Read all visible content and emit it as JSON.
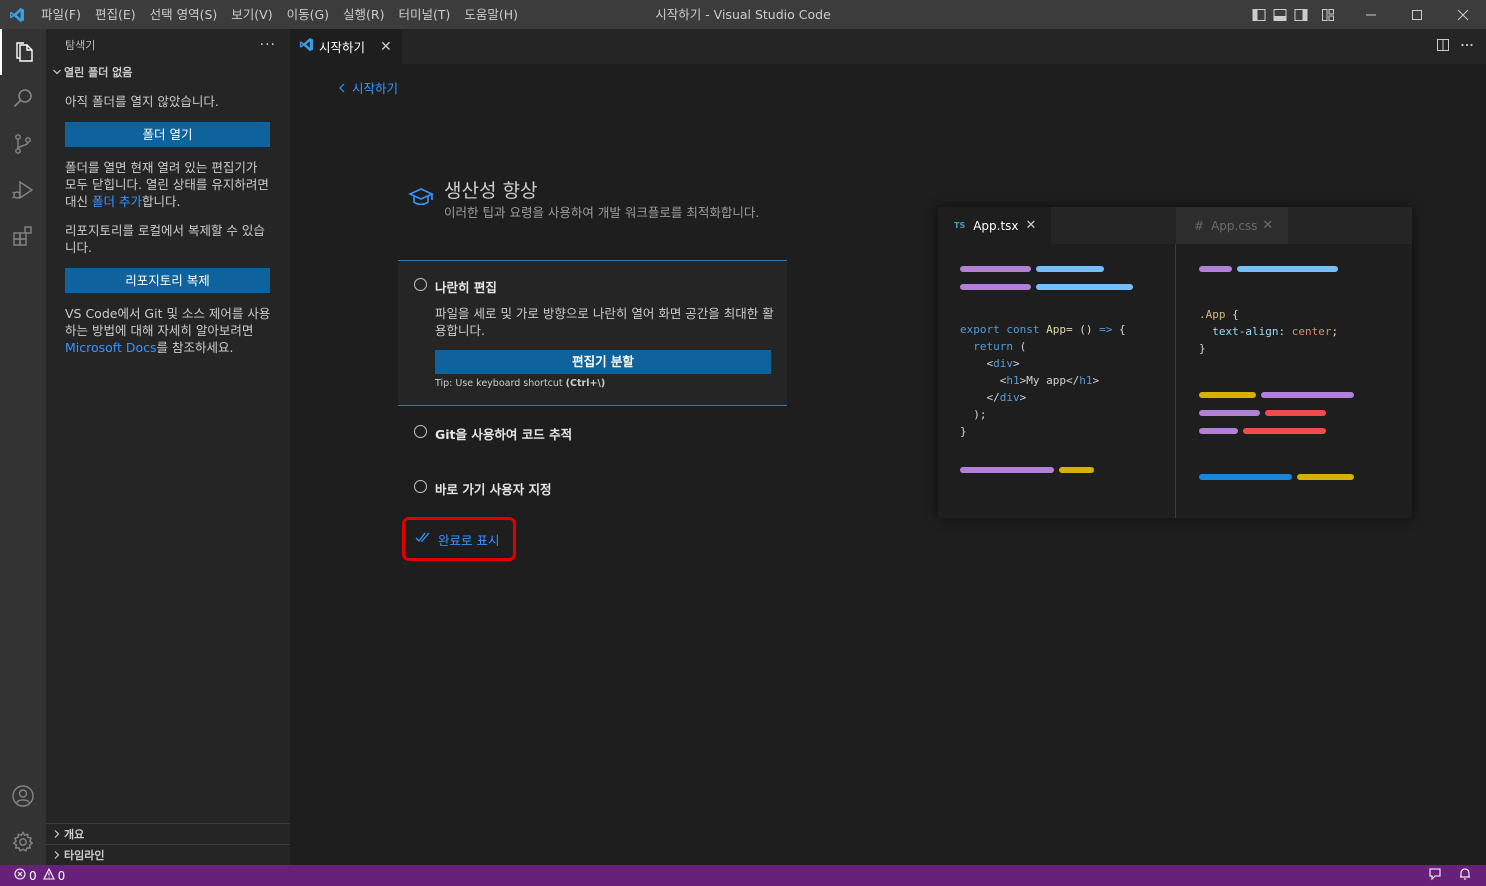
{
  "titlebar": {
    "menu": [
      "파일(F)",
      "편집(E)",
      "선택 영역(S)",
      "보기(V)",
      "이동(G)",
      "실행(R)",
      "터미널(T)",
      "도움말(H)"
    ],
    "title": "시작하기 - Visual Studio Code"
  },
  "sidebar": {
    "header": "탐색기",
    "more": "···",
    "section": "열린 폴더 없음",
    "no_folder_text": "아직 폴더를 열지 않았습니다.",
    "open_folder_button": "폴더 열기",
    "close_note_prefix": "폴더를 열면 현재 열려 있는 편집기가 모두 닫힙니다. 열린 상태를 유지하려면 대신 ",
    "close_note_link": "폴더 추가",
    "close_note_suffix": "합니다.",
    "clone_text": "리포지토리를 로컬에서 복제할 수 있습니다.",
    "clone_button": "리포지토리 복제",
    "learn_prefix": "VS Code에서 Git 및 소스 제어를 사용하는 방법에 대해 자세히 알아보려면 ",
    "learn_link": "Microsoft Docs",
    "learn_suffix": "를 참조하세요.",
    "outline": "개요",
    "timeline": "타임라인"
  },
  "tab": {
    "label": "시작하기",
    "close": "✕"
  },
  "walkthrough": {
    "back": "시작하기",
    "title": "생산성 향상",
    "subtitle": "이러한 팁과 요령을 사용하여 개발 워크플로를 최적화합니다.",
    "steps": [
      {
        "title": "나란히 편집",
        "description": "파일을 세로 및 가로 방향으로 나란히 열어 화면 공간을 최대한 활용합니다.",
        "button": "편집기 분할",
        "tip_prefix": "Tip: Use keyboard shortcut ",
        "tip_shortcut": "(Ctrl+\\)"
      },
      {
        "title": "Git을 사용하여 코드 추적"
      },
      {
        "title": "바로 가기 사용자 지정"
      }
    ],
    "mark_done": "완료로 표시"
  },
  "preview": {
    "tab1_badge": "TS",
    "tab1": "App.tsx",
    "tab2_badge": "#",
    "tab2": "App.css",
    "close": "✕",
    "tsx_code": [
      {
        "parts": [
          [
            "k",
            "export "
          ],
          [
            "k",
            "const "
          ],
          [
            "fn",
            "App"
          ],
          [
            "",
            "= () "
          ],
          [
            "k",
            "=>"
          ],
          [
            "",
            " {"
          ]
        ]
      },
      {
        "parts": [
          [
            "k",
            "  return"
          ],
          [
            "",
            " ("
          ]
        ]
      },
      {
        "parts": [
          [
            "",
            "    <"
          ],
          [
            "tg",
            "div"
          ],
          [
            "",
            ">"
          ]
        ]
      },
      {
        "parts": [
          [
            "",
            "      <"
          ],
          [
            "tg",
            "h1"
          ],
          [
            "",
            ">My app</"
          ],
          [
            "tg",
            "h1"
          ],
          [
            "",
            ">"
          ]
        ]
      },
      {
        "parts": [
          [
            "",
            "    </"
          ],
          [
            "tg",
            "div"
          ],
          [
            "",
            ">"
          ]
        ]
      },
      {
        "parts": [
          [
            "",
            "  );"
          ]
        ]
      },
      {
        "parts": [
          [
            "",
            "}"
          ]
        ]
      }
    ],
    "css_code": [
      {
        "parts": [
          [
            "sel",
            ".App"
          ],
          [
            "",
            " {"
          ]
        ]
      },
      {
        "parts": [
          [
            "prop",
            "  text-align"
          ],
          [
            "",
            ": "
          ],
          [
            "str",
            "center"
          ],
          [
            "",
            ";"
          ]
        ]
      },
      {
        "parts": [
          [
            "",
            "}"
          ]
        ]
      }
    ],
    "colors": {
      "purple": "#b180d7",
      "cyan": "#75beff",
      "yellow": "#d6b100",
      "red": "#f14c4c",
      "blue": "#1a85d9"
    }
  },
  "statusbar": {
    "errors": "0",
    "warnings": "0"
  },
  "colors": {
    "accent": "#0e639c",
    "link": "#3794ff",
    "statusbar": "#68217a",
    "highlight": "#e00000"
  }
}
